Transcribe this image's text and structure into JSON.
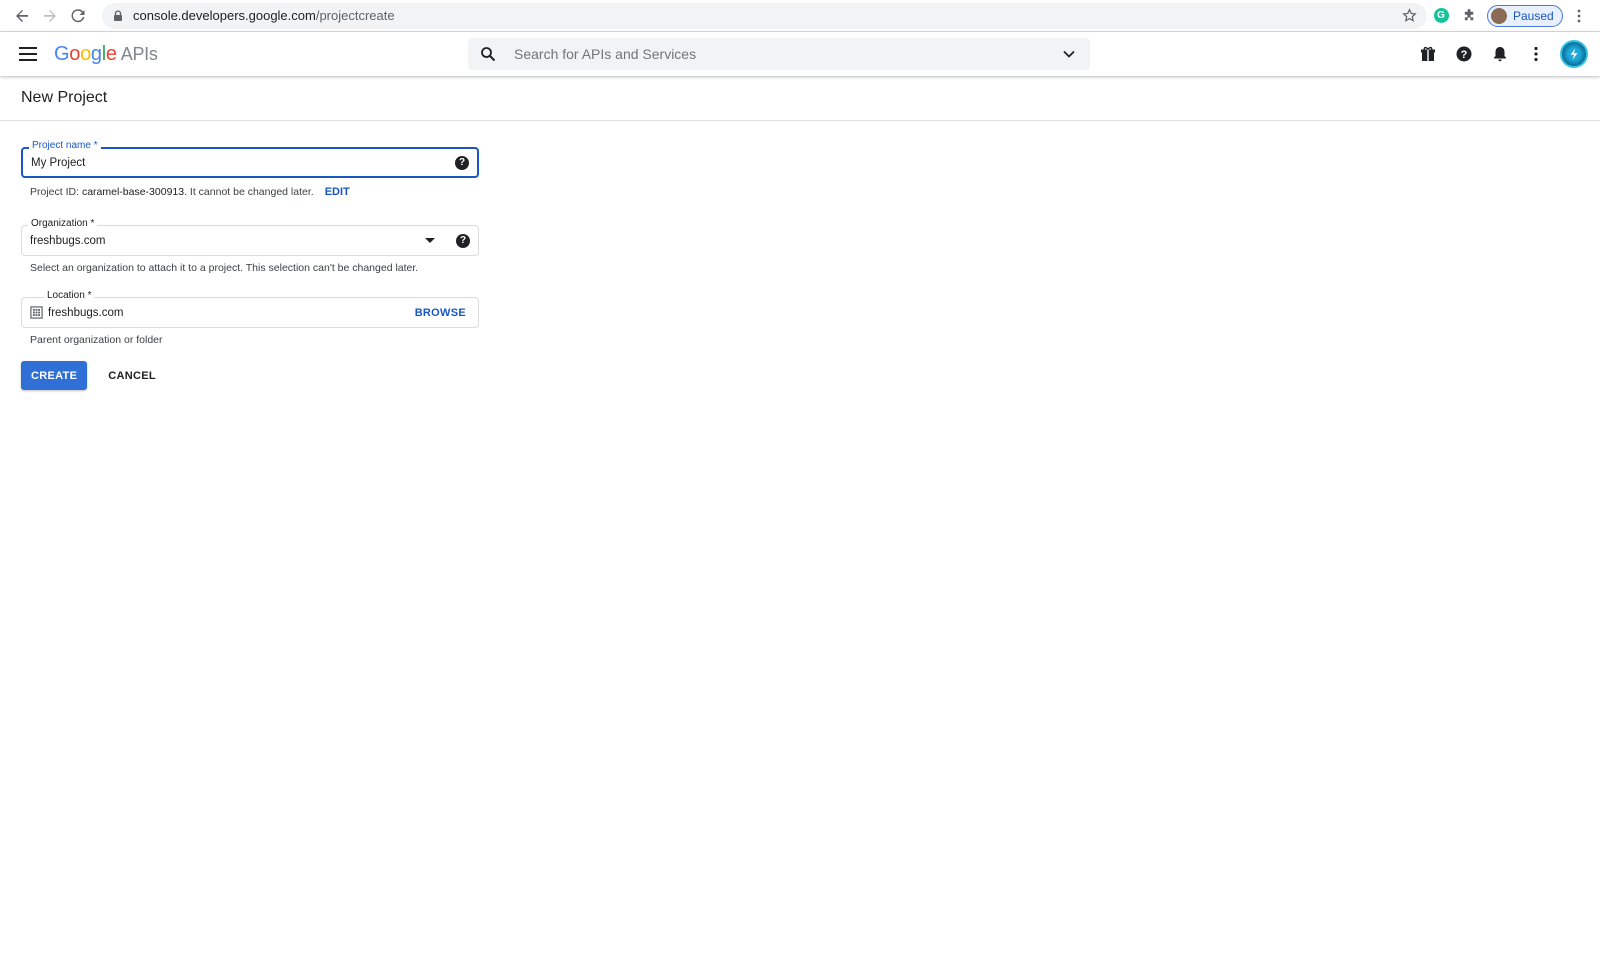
{
  "browser": {
    "url_host": "console.developers.google.com",
    "url_path": "/projectcreate",
    "profile_label": "Paused",
    "grammarly_letter": "G"
  },
  "appbar": {
    "logo_letters": [
      "G",
      "o",
      "o",
      "g",
      "l",
      "e"
    ],
    "logo_suffix": "APIs",
    "search_placeholder": "Search for APIs and Services",
    "icons": [
      "gift-icon",
      "help-icon",
      "notifications-icon",
      "more-vert-icon"
    ]
  },
  "page": {
    "title": "New Project"
  },
  "form": {
    "project_name": {
      "label": "Project name *",
      "value": "My Project"
    },
    "project_id_hint": {
      "prefix": "Project ID: ",
      "id": "caramel-base-300913",
      "suffix": ". It cannot be changed later.",
      "edit_label": "EDIT"
    },
    "organization": {
      "label": "Organization *",
      "value": "freshbugs.com",
      "hint": "Select an organization to attach it to a project. This selection can't be changed later."
    },
    "location": {
      "label": "Location *",
      "value": "freshbugs.com",
      "browse_label": "BROWSE",
      "hint": "Parent organization or folder"
    },
    "create_label": "CREATE",
    "cancel_label": "CANCEL"
  },
  "colors": {
    "accent": "#1a56c4",
    "primary_button": "#2f6fd6"
  }
}
